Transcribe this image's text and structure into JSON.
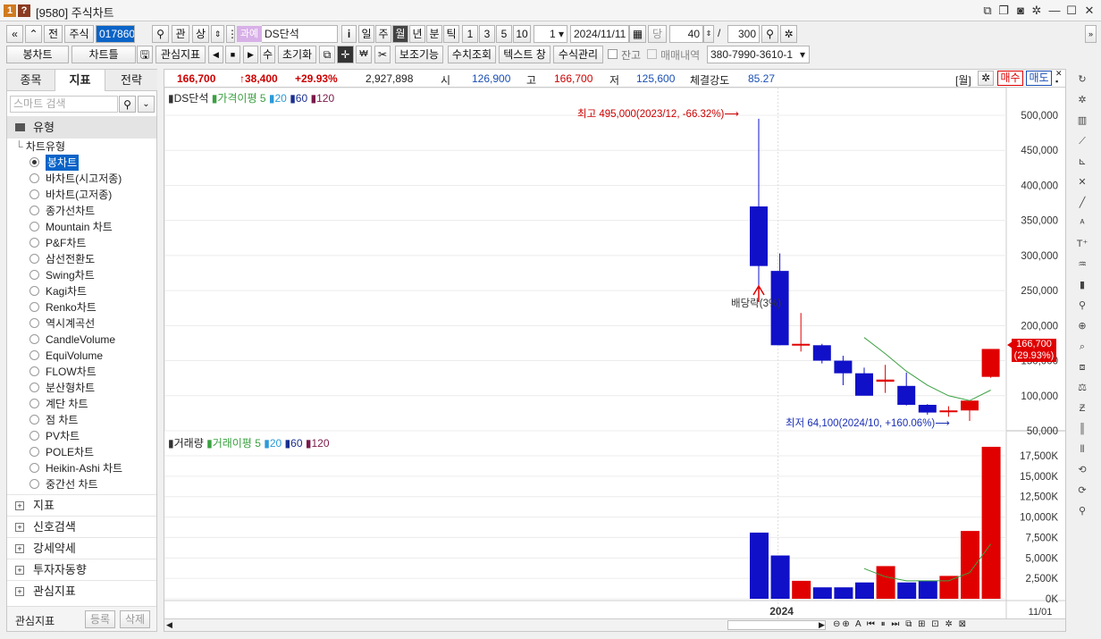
{
  "window": {
    "badge1": "1",
    "badge2": "?",
    "title": "[9580] 주식차트"
  },
  "toolbar1": {
    "nav_left": "«",
    "nav_up": "«",
    "prev": "전",
    "market": "주식",
    "code": "017860",
    "search_icon": "search-icon",
    "gwan": "관",
    "sang": "상",
    "tag": "과예",
    "stock_name": "DS단석",
    "info": "i",
    "periods": [
      "일",
      "주",
      "월",
      "년",
      "분",
      "틱"
    ],
    "active_period": "월",
    "mins": [
      "1",
      "3",
      "5",
      "10"
    ],
    "count_sel": "1",
    "date": "2024/11/11",
    "dang": "당",
    "count": "40",
    "slash": "/",
    "total": "300"
  },
  "toolbar2": {
    "chart_type": "봉차트",
    "chart_frame": "차트틀",
    "interest": "관심지표",
    "su": "수",
    "reset": "초기화",
    "aux": "보조기능",
    "value_view": "수치조회",
    "text_win": "텍스트 창",
    "formula": "수식관리",
    "balance": "잔고",
    "trade_history": "매매내역",
    "account": "380-7990-3610-1"
  },
  "left": {
    "tabs": [
      "종목",
      "지표",
      "전략"
    ],
    "active_tab": "지표",
    "search_placeholder": "스마트 검색",
    "group": "유형",
    "subgroup": "차트유형",
    "chart_types": [
      "봉차트",
      "바차트(시고저종)",
      "바차트(고저종)",
      "종가선차트",
      "Mountain 차트",
      "P&F차트",
      "삼선전환도",
      "Swing차트",
      "Kagi차트",
      "Renko차트",
      "역시계곡선",
      "CandleVolume",
      "EquiVolume",
      "FLOW차트",
      "분산형차트",
      "계단 차트",
      "점 차트",
      "PV차트",
      "POLE차트",
      "Heikin-Ashi 차트",
      "중간선 차트"
    ],
    "selected": "봉차트",
    "sections": [
      "지표",
      "신호검색",
      "강세약세",
      "투자자동향",
      "관심지표"
    ],
    "footer_label": "관심지표",
    "register": "등록",
    "delete": "삭제"
  },
  "quote": {
    "price": "166,700",
    "change": "↑38,400",
    "rate": "+29.93%",
    "volume": "2,927,898",
    "open_label": "시",
    "open": "126,900",
    "high_label": "고",
    "high": "166,700",
    "low_label": "저",
    "low": "125,600",
    "strength_label": "체결강도",
    "strength": "85.27",
    "week": "[월]",
    "buy": "매수",
    "sell": "매도"
  },
  "price_legend": {
    "name": "DS단석",
    "ma_label": "가격이평",
    "ma": [
      "5",
      "20",
      "60",
      "120"
    ]
  },
  "volume_legend": {
    "name": "거래량",
    "ma_label": "거래이평",
    "ma": [
      "5",
      "20",
      "60",
      "120"
    ]
  },
  "annotations": {
    "high": "최고 495,000(2023/12, -66.32%)⟶",
    "low": "최저 64,100(2024/10, +160.06%)⟶",
    "dividend": "배당락(3%)",
    "last_price": "166,700",
    "last_rate": "(29.93%)"
  },
  "price_axis": [
    "500,000",
    "450,000",
    "400,000",
    "350,000",
    "300,000",
    "250,000",
    "200,000",
    "150,000",
    "100,000",
    "50,000"
  ],
  "volume_axis": [
    "17,500K",
    "15,000K",
    "12,500K",
    "10,000K",
    "7,500K",
    "5,000K",
    "2,500K",
    "0K"
  ],
  "x_axis": {
    "year": "2024",
    "date": "11/01"
  },
  "colors": {
    "up": "#e00000",
    "down": "#1010c8",
    "ma5": "#3aa040"
  },
  "chart_data": {
    "type": "candlestick",
    "x": [
      "2023/12",
      "2024/01",
      "2024/02",
      "2024/03",
      "2024/04",
      "2024/05",
      "2024/06",
      "2024/07",
      "2024/08",
      "2024/09",
      "2024/10",
      "2024/11"
    ],
    "open": [
      370000,
      278000,
      172000,
      172000,
      150000,
      132000,
      120000,
      114000,
      87000,
      79000,
      79000,
      126900
    ],
    "high": [
      495000,
      303000,
      218000,
      174000,
      157000,
      140000,
      144000,
      133000,
      88000,
      85000,
      90000,
      166700
    ],
    "low": [
      248000,
      172000,
      163000,
      146000,
      115000,
      101000,
      104000,
      86000,
      73000,
      70000,
      64100,
      125600
    ],
    "close": [
      285000,
      172000,
      174000,
      150000,
      132000,
      100000,
      123000,
      87000,
      76000,
      79000,
      93000,
      166700
    ],
    "volume_k": [
      8100,
      5300,
      2200,
      1400,
      1400,
      2000,
      4000,
      2000,
      2200,
      2800,
      8300,
      18600
    ],
    "ma5": [
      null,
      null,
      null,
      null,
      null,
      183000,
      160000,
      135000,
      115000,
      100000,
      93000,
      108000
    ],
    "vol_ma5": [
      null,
      null,
      null,
      null,
      null,
      3700,
      2700,
      2200,
      2200,
      2200,
      3200,
      6700
    ]
  }
}
